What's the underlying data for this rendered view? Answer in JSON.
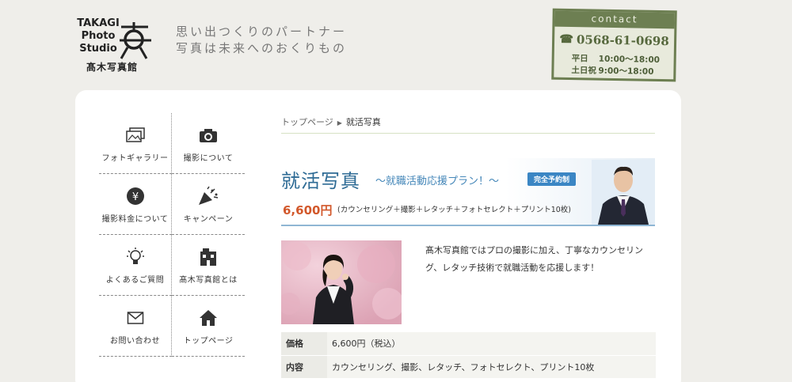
{
  "header": {
    "logo_line1": "TAKAGI",
    "logo_line2": "Photo",
    "logo_line3": "Studio",
    "logo_sub": "髙木写真館",
    "tagline_1": "思い出つくりのパートナー",
    "tagline_2": "写真は未来へのおくりもの"
  },
  "contact": {
    "label": "contact",
    "tel": "0568-61-0698",
    "hours": [
      {
        "day": "平日",
        "time": "10:00〜18:00"
      },
      {
        "day": "土日祝",
        "time": "9:00〜18:00"
      }
    ]
  },
  "nav": {
    "items": [
      {
        "label": "フォトギャラリー",
        "icon": "photo-gallery-icon"
      },
      {
        "label": "撮影について",
        "icon": "camera-icon"
      },
      {
        "label": "撮影料金について",
        "icon": "yen-coin-icon"
      },
      {
        "label": "キャンペーン",
        "icon": "party-popper-icon"
      },
      {
        "label": "よくあるご質問",
        "icon": "lightbulb-icon"
      },
      {
        "label": "髙木写真館とは",
        "icon": "building-icon"
      },
      {
        "label": "お問い合わせ",
        "icon": "mail-icon"
      },
      {
        "label": "トップページ",
        "icon": "home-icon"
      }
    ]
  },
  "breadcrumb": {
    "home": "トップページ",
    "current": "就活写真"
  },
  "banner": {
    "title": "就活写真",
    "subtitle": "〜就職活動応援プラン！〜",
    "badge": "完全予約制",
    "price": "6,600円",
    "desc": "(カウンセリング＋撮影＋レタッチ＋フォトセレクト＋プリント10枚)"
  },
  "intro": {
    "text": "髙木写真館ではプロの撮影に加え、丁寧なカウンセリング、レタッチ技術で就職活動を応援します！"
  },
  "table": {
    "rows": [
      {
        "label": "価格",
        "value": "6,600円（税込）"
      },
      {
        "label": "内容",
        "value": "カウンセリング、撮影、レタッチ、フォトセレクト、プリント10枚"
      }
    ]
  }
}
